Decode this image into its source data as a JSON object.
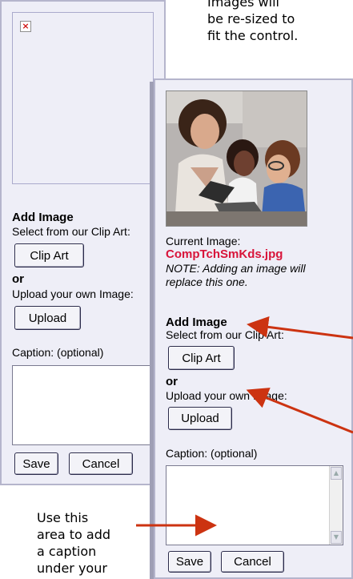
{
  "note_top": [
    "Images will",
    "be re-sized to",
    "fit the control."
  ],
  "note_bottom": [
    "Use this",
    "area to add",
    "a caption",
    "under your"
  ],
  "back_panel": {
    "broken_image_glyph": "×",
    "add_image_heading": "Add Image",
    "select_text": "Select from our Clip Art:",
    "clip_art_label": "Clip Art",
    "or_text": "or",
    "upload_text": "Upload your own Image:",
    "upload_label": "Upload",
    "caption_label": "Caption: (optional)",
    "save_label": "Save",
    "cancel_label": "Cancel"
  },
  "front_panel": {
    "current_image_label": "Current Image:",
    "current_image_file": "CompTchSmKds.jpg",
    "note_line1": "NOTE: Adding an image will",
    "note_line2": "replace this one.",
    "add_image_heading": "Add Image",
    "select_text": "Select from our Clip Art:",
    "clip_art_label": "Clip Art",
    "or_text": "or",
    "upload_text": "Upload your own Image:",
    "upload_label": "Upload",
    "caption_label": "Caption: (optional)",
    "save_label": "Save",
    "cancel_label": "Cancel"
  },
  "colors": {
    "panel_bg": "#eeeef7",
    "filename_red": "#d8143a",
    "arrow_red": "#cc3311"
  }
}
